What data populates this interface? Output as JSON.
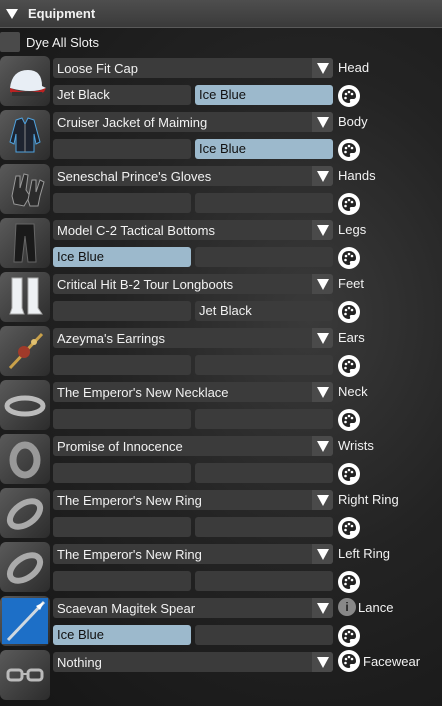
{
  "header": {
    "title": "Equipment"
  },
  "dye_all": {
    "label": "Dye All Slots"
  },
  "info_icon": "i",
  "rows": [
    {
      "item": "Loose Fit Cap",
      "dye1": "Jet Black",
      "dye2": "Ice Blue",
      "slot": "Head",
      "icon": "cap-icon"
    },
    {
      "item": "Cruiser Jacket of Maiming",
      "dye1": "",
      "dye2": "Ice Blue",
      "slot": "Body",
      "icon": "jacket-icon"
    },
    {
      "item": "Seneschal Prince's Gloves",
      "dye1": "",
      "dye2": "",
      "slot": "Hands",
      "icon": "gloves-icon"
    },
    {
      "item": "Model C-2 Tactical Bottoms",
      "dye1": "Ice Blue",
      "dye2": "",
      "slot": "Legs",
      "icon": "pants-icon"
    },
    {
      "item": "Critical Hit B-2 Tour Longboots",
      "dye1": "",
      "dye2": "Jet Black",
      "slot": "Feet",
      "icon": "boots-icon"
    },
    {
      "item": "Azeyma's Earrings",
      "dye1": "",
      "dye2": "",
      "slot": "Ears",
      "icon": "earrings-icon"
    },
    {
      "item": "The Emperor's New Necklace",
      "dye1": "",
      "dye2": "",
      "slot": "Neck",
      "icon": "necklace-icon"
    },
    {
      "item": "Promise of Innocence",
      "dye1": "",
      "dye2": "",
      "slot": "Wrists",
      "icon": "bracelet-icon"
    },
    {
      "item": "The Emperor's New Ring",
      "dye1": "",
      "dye2": "",
      "slot": "Right Ring",
      "icon": "ring-icon"
    },
    {
      "item": "The Emperor's New Ring",
      "dye1": "",
      "dye2": "",
      "slot": "Left Ring",
      "icon": "ring-icon"
    },
    {
      "item": "Scaevan Magitek Spear",
      "dye1": "Ice Blue",
      "dye2": "",
      "slot": "Lance",
      "icon": "spear-icon"
    },
    {
      "item": "Nothing",
      "slot": "Facewear",
      "icon": "glasses-icon"
    }
  ],
  "colors": {
    "ice_blue": "#9cb9cc",
    "field": "#3b3b3b"
  }
}
